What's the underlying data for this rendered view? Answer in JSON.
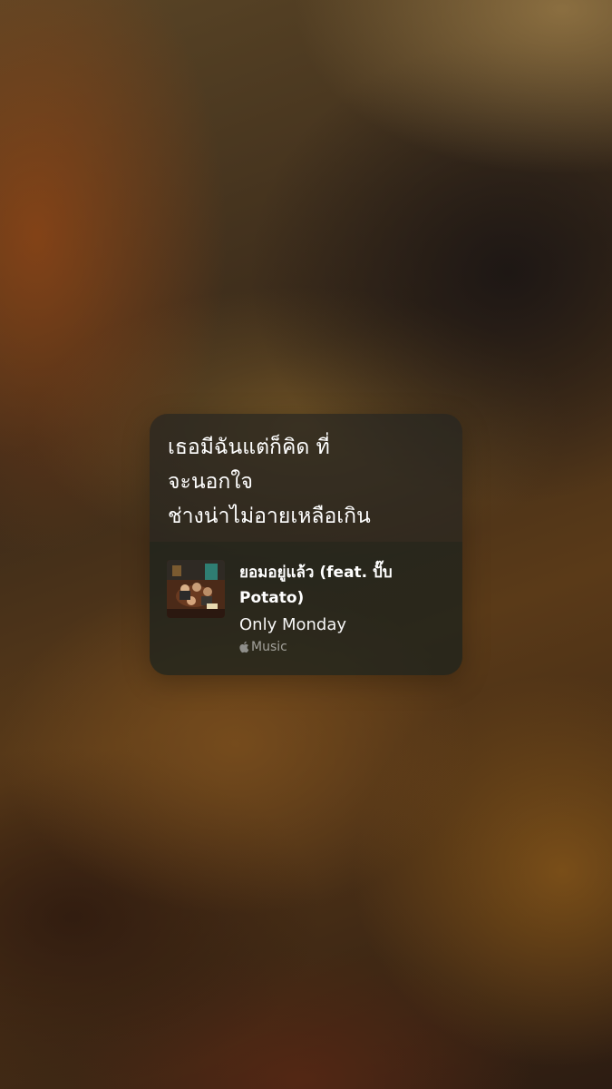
{
  "lyrics_card": {
    "lines": [
      "เธอมีฉันแต่ก็คิด ที่",
      "จะนอกใจ",
      "ช่างน่าไม่อายเหลือเกิน"
    ],
    "track": {
      "title": "ยอมอยู่แล้ว (feat. ปั๊บ Potato)",
      "artist": "Only Monday",
      "service_icon": "apple-logo-icon",
      "service_label": "Music"
    }
  },
  "colors": {
    "text_primary": "#ffffff",
    "text_secondary": "#9a9a96"
  }
}
